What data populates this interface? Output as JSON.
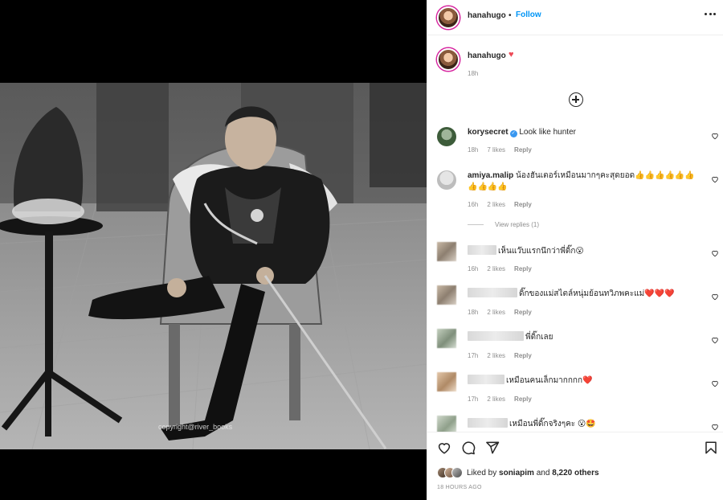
{
  "post": {
    "username": "hanahugo",
    "follow_label": "Follow",
    "separator": "•",
    "photo_watermark": "copyright@river_books"
  },
  "caption": {
    "username": "hanahugo",
    "emoji": "♥",
    "time": "18h"
  },
  "comments": [
    {
      "username": "korysecret",
      "verified": true,
      "text": "Look like hunter",
      "time": "18h",
      "likes": "7 likes",
      "reply": "Reply"
    },
    {
      "username": "amiya.malip",
      "verified": false,
      "text": "น้องฮันเตอร์เหมือนมากๆคะสุดยอด👍👍👍👍👍👍👍👍👍👍",
      "time": "16h",
      "likes": "2 likes",
      "reply": "Reply",
      "view_replies": "View replies (1)"
    },
    {
      "username": "",
      "text": "เห็นแว๊บแรกนึกว่าพี่ดิ๊ก😮",
      "time": "16h",
      "likes": "2 likes",
      "reply": "Reply"
    },
    {
      "username": "",
      "text": "ดิ๊กของแม่สไตล์หนุ่มย้อนทวิภพคะแม่❤️❤️❤️",
      "time": "18h",
      "likes": "2 likes",
      "reply": "Reply"
    },
    {
      "username": "",
      "text": "พี่ดิ๊กเลย",
      "time": "17h",
      "likes": "2 likes",
      "reply": "Reply"
    },
    {
      "username": "",
      "text": "เหมือนคนเล็กมากกกก❤️",
      "time": "17h",
      "likes": "2 likes",
      "reply": "Reply"
    },
    {
      "username": "",
      "text": "เหมือนพี่ดิ๊กจริงๆคะ 😮🤩",
      "time": "",
      "likes": "",
      "reply": ""
    }
  ],
  "footer": {
    "liked_by_prefix": "Liked by",
    "liked_by_user": "soniapim",
    "liked_by_and": "and",
    "liked_by_others": "8,220 others",
    "timestamp": "18 HOURS AGO"
  },
  "icons": {
    "more": "more-icon",
    "load_more": "plus-circle-icon",
    "like": "heart-icon",
    "comment": "comment-icon",
    "share": "share-icon",
    "save": "bookmark-icon"
  },
  "colors": {
    "accent": "#0095f6",
    "heart": "#ed4956",
    "muted": "#8e8e8e"
  }
}
